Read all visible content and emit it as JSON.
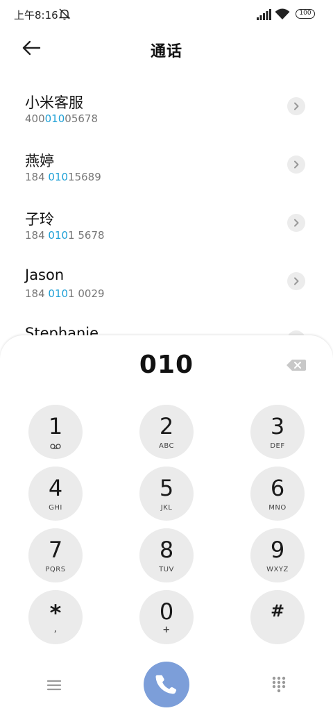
{
  "status_bar": {
    "time": "上午8:16",
    "battery": "100",
    "icons": [
      "mute-notification-icon",
      "signal-icon",
      "wifi-icon",
      "battery-icon"
    ]
  },
  "header": {
    "title": "通话",
    "back_icon": "back-arrow-icon"
  },
  "contacts": [
    {
      "name": "小米客服",
      "number_pre": "400",
      "number_hl": "010",
      "number_post": "05678"
    },
    {
      "name": "燕婷",
      "number_pre": "184 ",
      "number_hl": "010",
      "number_post": "15689"
    },
    {
      "name": "子玲",
      "number_pre": "184 ",
      "number_hl": "010",
      "number_post": "1 5678"
    },
    {
      "name": "Jason",
      "number_pre": "184 ",
      "number_hl": "010",
      "number_post": "1 0029"
    },
    {
      "name": "Stephanie",
      "number_pre": "",
      "number_hl": "",
      "number_post": ""
    }
  ],
  "dialer": {
    "input": "010",
    "keys": [
      {
        "digit": "1",
        "letters": ""
      },
      {
        "digit": "2",
        "letters": "ABC"
      },
      {
        "digit": "3",
        "letters": "DEF"
      },
      {
        "digit": "4",
        "letters": "GHI"
      },
      {
        "digit": "5",
        "letters": "JKL"
      },
      {
        "digit": "6",
        "letters": "MNO"
      },
      {
        "digit": "7",
        "letters": "PQRS"
      },
      {
        "digit": "8",
        "letters": "TUV"
      },
      {
        "digit": "9",
        "letters": "WXYZ"
      },
      {
        "digit": "*",
        "letters": ","
      },
      {
        "digit": "0",
        "letters": "+"
      },
      {
        "digit": "#",
        "letters": ""
      }
    ]
  },
  "colors": {
    "highlight": "#1ea0d6",
    "call_button": "#7c9ed9",
    "key_background": "#ebebeb"
  }
}
